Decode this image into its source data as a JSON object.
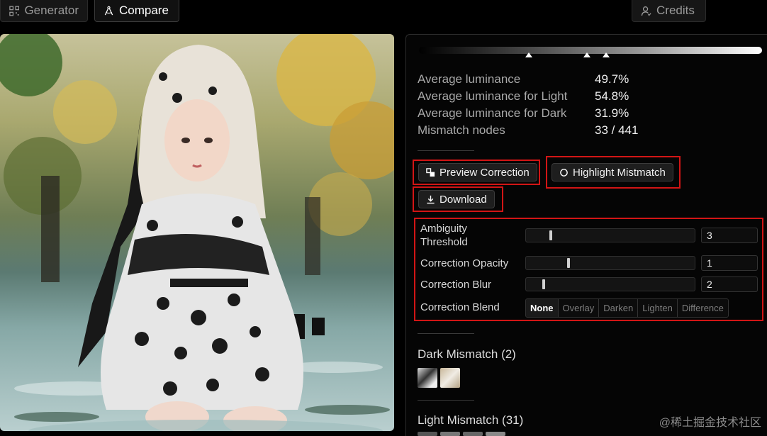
{
  "tabs": {
    "generator": "Generator",
    "compare": "Compare",
    "credits": "Credits"
  },
  "stats": {
    "avg_luminance_label": "Average luminance",
    "avg_luminance_value": "49.7%",
    "avg_light_label": "Average luminance for Light",
    "avg_light_value": "54.8%",
    "avg_dark_label": "Average luminance for Dark",
    "avg_dark_value": "31.9%",
    "mismatch_label": "Mismatch nodes",
    "mismatch_value": "33 / 441"
  },
  "luminance_markers": [
    0.32,
    0.49,
    0.545
  ],
  "buttons": {
    "preview_correction": "Preview Correction",
    "highlight_mismatch": "Highlight Mistmatch",
    "download": "Download"
  },
  "controls": {
    "ambiguity_label_line1": "Ambiguity",
    "ambiguity_label_line2": "Threshold",
    "ambiguity_value": "3",
    "opacity_label": "Correction Opacity",
    "opacity_value": "1",
    "blur_label": "Correction Blur",
    "blur_value": "2",
    "blend_label": "Correction Blend",
    "blend_options": [
      "None",
      "Overlay",
      "Darken",
      "Lighten",
      "Difference"
    ],
    "blend_selected": "None"
  },
  "sections": {
    "dark_mismatch": "Dark Mismatch (2)",
    "light_mismatch": "Light Mismatch (31)"
  },
  "watermark": "@稀土掘金技术社区",
  "colors": {
    "highlight": "#d21515",
    "panel_bg": "#050505",
    "button_bg": "#1e1e1e"
  }
}
